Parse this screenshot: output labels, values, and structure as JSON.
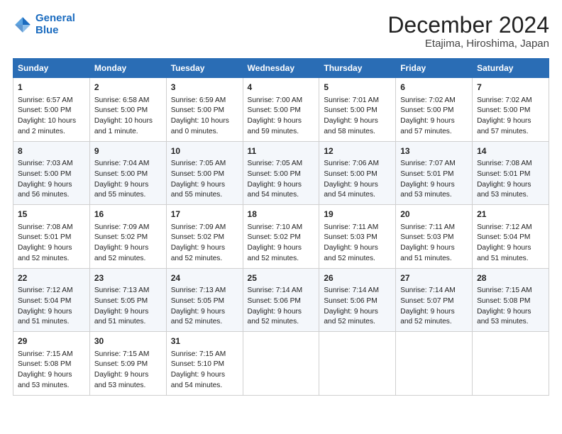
{
  "header": {
    "logo_line1": "General",
    "logo_line2": "Blue",
    "title": "December 2024",
    "subtitle": "Etajima, Hiroshima, Japan"
  },
  "days_of_week": [
    "Sunday",
    "Monday",
    "Tuesday",
    "Wednesday",
    "Thursday",
    "Friday",
    "Saturday"
  ],
  "weeks": [
    [
      {
        "day": 1,
        "sunrise": "6:57 AM",
        "sunset": "5:00 PM",
        "daylight": "10 hours and 2 minutes."
      },
      {
        "day": 2,
        "sunrise": "6:58 AM",
        "sunset": "5:00 PM",
        "daylight": "10 hours and 1 minute."
      },
      {
        "day": 3,
        "sunrise": "6:59 AM",
        "sunset": "5:00 PM",
        "daylight": "10 hours and 0 minutes."
      },
      {
        "day": 4,
        "sunrise": "7:00 AM",
        "sunset": "5:00 PM",
        "daylight": "9 hours and 59 minutes."
      },
      {
        "day": 5,
        "sunrise": "7:01 AM",
        "sunset": "5:00 PM",
        "daylight": "9 hours and 58 minutes."
      },
      {
        "day": 6,
        "sunrise": "7:02 AM",
        "sunset": "5:00 PM",
        "daylight": "9 hours and 57 minutes."
      },
      {
        "day": 7,
        "sunrise": "7:02 AM",
        "sunset": "5:00 PM",
        "daylight": "9 hours and 57 minutes."
      }
    ],
    [
      {
        "day": 8,
        "sunrise": "7:03 AM",
        "sunset": "5:00 PM",
        "daylight": "9 hours and 56 minutes."
      },
      {
        "day": 9,
        "sunrise": "7:04 AM",
        "sunset": "5:00 PM",
        "daylight": "9 hours and 55 minutes."
      },
      {
        "day": 10,
        "sunrise": "7:05 AM",
        "sunset": "5:00 PM",
        "daylight": "9 hours and 55 minutes."
      },
      {
        "day": 11,
        "sunrise": "7:05 AM",
        "sunset": "5:00 PM",
        "daylight": "9 hours and 54 minutes."
      },
      {
        "day": 12,
        "sunrise": "7:06 AM",
        "sunset": "5:00 PM",
        "daylight": "9 hours and 54 minutes."
      },
      {
        "day": 13,
        "sunrise": "7:07 AM",
        "sunset": "5:01 PM",
        "daylight": "9 hours and 53 minutes."
      },
      {
        "day": 14,
        "sunrise": "7:08 AM",
        "sunset": "5:01 PM",
        "daylight": "9 hours and 53 minutes."
      }
    ],
    [
      {
        "day": 15,
        "sunrise": "7:08 AM",
        "sunset": "5:01 PM",
        "daylight": "9 hours and 52 minutes."
      },
      {
        "day": 16,
        "sunrise": "7:09 AM",
        "sunset": "5:02 PM",
        "daylight": "9 hours and 52 minutes."
      },
      {
        "day": 17,
        "sunrise": "7:09 AM",
        "sunset": "5:02 PM",
        "daylight": "9 hours and 52 minutes."
      },
      {
        "day": 18,
        "sunrise": "7:10 AM",
        "sunset": "5:02 PM",
        "daylight": "9 hours and 52 minutes."
      },
      {
        "day": 19,
        "sunrise": "7:11 AM",
        "sunset": "5:03 PM",
        "daylight": "9 hours and 52 minutes."
      },
      {
        "day": 20,
        "sunrise": "7:11 AM",
        "sunset": "5:03 PM",
        "daylight": "9 hours and 51 minutes."
      },
      {
        "day": 21,
        "sunrise": "7:12 AM",
        "sunset": "5:04 PM",
        "daylight": "9 hours and 51 minutes."
      }
    ],
    [
      {
        "day": 22,
        "sunrise": "7:12 AM",
        "sunset": "5:04 PM",
        "daylight": "9 hours and 51 minutes."
      },
      {
        "day": 23,
        "sunrise": "7:13 AM",
        "sunset": "5:05 PM",
        "daylight": "9 hours and 51 minutes."
      },
      {
        "day": 24,
        "sunrise": "7:13 AM",
        "sunset": "5:05 PM",
        "daylight": "9 hours and 52 minutes."
      },
      {
        "day": 25,
        "sunrise": "7:14 AM",
        "sunset": "5:06 PM",
        "daylight": "9 hours and 52 minutes."
      },
      {
        "day": 26,
        "sunrise": "7:14 AM",
        "sunset": "5:06 PM",
        "daylight": "9 hours and 52 minutes."
      },
      {
        "day": 27,
        "sunrise": "7:14 AM",
        "sunset": "5:07 PM",
        "daylight": "9 hours and 52 minutes."
      },
      {
        "day": 28,
        "sunrise": "7:15 AM",
        "sunset": "5:08 PM",
        "daylight": "9 hours and 53 minutes."
      }
    ],
    [
      {
        "day": 29,
        "sunrise": "7:15 AM",
        "sunset": "5:08 PM",
        "daylight": "9 hours and 53 minutes."
      },
      {
        "day": 30,
        "sunrise": "7:15 AM",
        "sunset": "5:09 PM",
        "daylight": "9 hours and 53 minutes."
      },
      {
        "day": 31,
        "sunrise": "7:15 AM",
        "sunset": "5:10 PM",
        "daylight": "9 hours and 54 minutes."
      },
      null,
      null,
      null,
      null
    ]
  ],
  "labels": {
    "sunrise": "Sunrise:",
    "sunset": "Sunset:",
    "daylight": "Daylight:"
  }
}
